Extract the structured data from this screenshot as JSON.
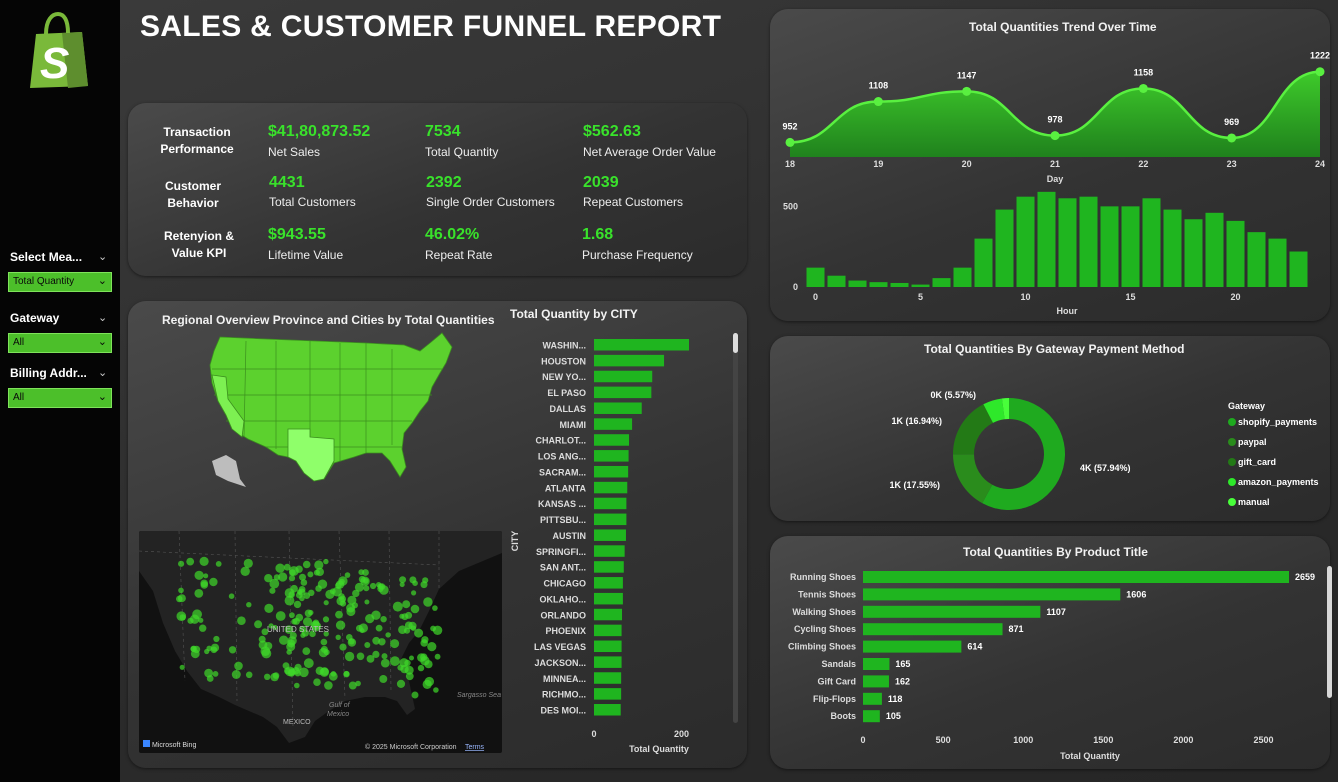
{
  "header": {
    "title": "SALES & CUSTOMER FUNNEL REPORT"
  },
  "logo": {
    "letter": "S",
    "icon": "shopify-bag-icon",
    "color": "#7ab93a"
  },
  "slicers": [
    {
      "label": "Select Mea...",
      "value": "Total Quantity"
    },
    {
      "label": "Gateway",
      "value": "All"
    },
    {
      "label": "Billing Addr...",
      "value": "All"
    }
  ],
  "kpis": {
    "groups": [
      {
        "line1": "Transaction",
        "line2": "Performance"
      },
      {
        "line1": "Customer",
        "line2": "Behavior"
      },
      {
        "line1": "Retenyion &",
        "line2": "Value KPI"
      }
    ],
    "items": [
      {
        "value": "$41,80,873.52",
        "label": "Net Sales"
      },
      {
        "value": "7534",
        "label": "Total Quantity"
      },
      {
        "value": "$562.63",
        "label": "Net Average Order Value"
      },
      {
        "value": "4431",
        "label": "Total Customers"
      },
      {
        "value": "2392",
        "label": "Single Order Customers"
      },
      {
        "value": "2039",
        "label": "Repeat Customers"
      },
      {
        "value": "$943.55",
        "label": "Lifetime Value"
      },
      {
        "value": "46.02%",
        "label": "Repeat Rate"
      },
      {
        "value": "1.68",
        "label": "Purchase Frequency"
      }
    ]
  },
  "regional": {
    "title": "Regional Overview Province and Cities by Total Quantities",
    "map_labels": {
      "country": "UNITED STATES",
      "gulf1": "Gulf of",
      "gulf2": "Mexico",
      "mexico": "MEXICO",
      "sargasso": "Sargasso Sea",
      "bing": "Microsoft Bing",
      "copyright": "© 2025 Microsoft Corporation",
      "terms": "Terms"
    }
  },
  "colors": {
    "accent": "#39e22b",
    "bar": "#1fb51f",
    "line": "#59f040"
  },
  "chart_data": [
    {
      "type": "area",
      "title": "Total Quantities Trend Over Time",
      "xlabel": "Day",
      "x": [
        18,
        19,
        20,
        21,
        22,
        23,
        24
      ],
      "values": [
        952,
        1108,
        1147,
        978,
        1158,
        969,
        1222
      ]
    },
    {
      "type": "bar",
      "xlabel": "Hour",
      "x": [
        0,
        1,
        2,
        3,
        4,
        5,
        6,
        7,
        8,
        9,
        10,
        11,
        12,
        13,
        14,
        15,
        16,
        17,
        18,
        19,
        20,
        21,
        22,
        23
      ],
      "xticks": [
        0,
        5,
        10,
        15,
        20
      ],
      "yticks": [
        0,
        500
      ],
      "ylim": [
        0,
        620
      ],
      "values": [
        120,
        70,
        40,
        30,
        25,
        15,
        55,
        120,
        300,
        480,
        560,
        590,
        550,
        560,
        500,
        500,
        550,
        480,
        420,
        460,
        410,
        340,
        300,
        220
      ]
    },
    {
      "type": "bar",
      "title": "Total Quantity by CITY",
      "ylabel": "CITY",
      "xlabel": "Total Quantity",
      "xticks": [
        0,
        200
      ],
      "xlim": [
        0,
        310
      ],
      "categories": [
        "WASHIN...",
        "HOUSTON",
        "NEW YO...",
        "EL PASO",
        "DALLAS",
        "MIAMI",
        "CHARLOT...",
        "LOS ANG...",
        "SACRAM...",
        "ATLANTA",
        "KANSAS ...",
        "PITTSBU...",
        "AUSTIN",
        "SPRINGFI...",
        "SAN ANT...",
        "CHICAGO",
        "OKLAHO...",
        "ORLANDO",
        "PHOENIX",
        "LAS VEGAS",
        "JACKSON...",
        "MINNEA...",
        "RICHMO...",
        "DES MOI..."
      ],
      "values": [
        217,
        160,
        133,
        131,
        109,
        87,
        80,
        79,
        78,
        76,
        74,
        74,
        73,
        70,
        68,
        66,
        66,
        64,
        63,
        63,
        63,
        62,
        62,
        61
      ]
    },
    {
      "type": "pie",
      "title": "Total Quantities By Gateway Payment Method",
      "legend_title": "Gateway",
      "legend": "right",
      "labels": [
        "shopify_payments",
        "paypal",
        "gift_card",
        "amazon_payments",
        "manual"
      ],
      "values": [
        57.94,
        16.94,
        17.55,
        5.57,
        2.0
      ],
      "data_labels": [
        "4K (57.94%)",
        "1K (16.94%)",
        "1K (17.55%)",
        "0K (5.57%)",
        ""
      ],
      "colors": [
        "#1faa1f",
        "#2a8c1c",
        "#237a16",
        "#2ee82a",
        "#48ff3a"
      ]
    },
    {
      "type": "bar",
      "title": "Total Quantities By Product Title",
      "xlabel": "Total Quantity",
      "xticks": [
        0,
        500,
        1000,
        1500,
        2000,
        2500
      ],
      "xlim": [
        0,
        2680
      ],
      "categories": [
        "Running Shoes",
        "Tennis Shoes",
        "Walking Shoes",
        "Cycling Shoes",
        "Climbing Shoes",
        "Sandals",
        "Gift Card",
        "Flip-Flops",
        "Boots"
      ],
      "values": [
        2659,
        1606,
        1107,
        871,
        614,
        165,
        162,
        118,
        105
      ]
    }
  ]
}
